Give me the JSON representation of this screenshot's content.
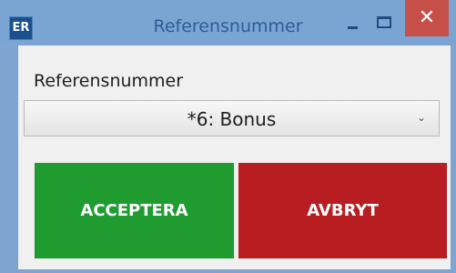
{
  "window": {
    "app_icon_text": "ER",
    "title": "Referensnummer",
    "minimize_icon": "minimize-icon",
    "maximize_icon": "maximize-icon",
    "close_glyph": "✕"
  },
  "form": {
    "label": "Referensnummer",
    "select_value": "*6: Bonus",
    "select_chevron": "⌄"
  },
  "buttons": {
    "accept_label": "ACCEPTERA",
    "cancel_label": "AVBRYT"
  },
  "colors": {
    "titlebar": "#7aa5d3",
    "close": "#c74f4a",
    "accept": "#1f9b2f",
    "cancel": "#b71d21"
  }
}
